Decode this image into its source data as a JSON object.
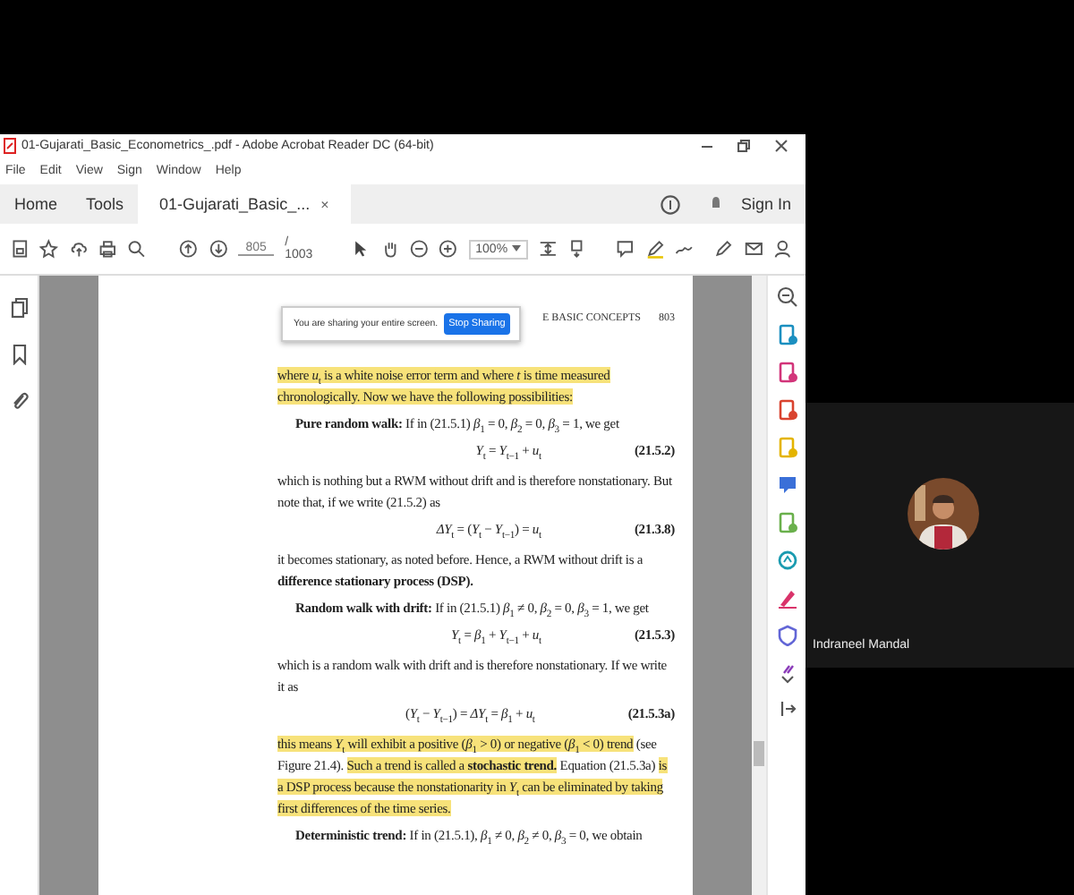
{
  "window": {
    "title": "01-Gujarati_Basic_Econometrics_.pdf - Adobe Acrobat Reader DC (64-bit)"
  },
  "menu": [
    "File",
    "Edit",
    "View",
    "Sign",
    "Window",
    "Help"
  ],
  "tabs": [
    {
      "label": "Home",
      "selected": false
    },
    {
      "label": "Tools",
      "selected": false
    },
    {
      "label": "01-Gujarati_Basic_...",
      "selected": true,
      "close": "×"
    }
  ],
  "sign_in": "Sign In",
  "toolbar": {
    "page": "805",
    "page_total": "/ 1003",
    "zoom": "100%"
  },
  "share_banner": {
    "message": "You are sharing your entire screen.",
    "button": "Stop Sharing"
  },
  "page": {
    "running_head": "E BASIC CONCEPTS",
    "page_number": "803",
    "blocks": [
      {
        "kind": "para",
        "indent": false,
        "segments": [
          {
            "text": "where *u*$_{t}$ is a white noise error term and where *t* is time measured chronologically. Now we have the following possibilities:",
            "highlighted": true
          }
        ]
      },
      {
        "kind": "para",
        "indent": true,
        "segments": [
          {
            "text": "**Pure random walk:** If in (21.5.1) *β*$_{1}$ = 0, *β*$_{2}$ = 0, *β*$_{3}$ = 1, we get",
            "highlighted": false
          }
        ]
      },
      {
        "kind": "equation",
        "formula": "*Y*$_{t}$ = *Y*$_{t−1}$ + *u*$_{t}$",
        "number": "(21.5.2)"
      },
      {
        "kind": "para",
        "indent": false,
        "segments": [
          {
            "text": "which is nothing but a RWM without drift and is therefore nonstationary. But note that, if we write (21.5.2) as",
            "highlighted": false
          }
        ]
      },
      {
        "kind": "equation",
        "formula": "*ΔY*$_{t}$ = (*Y*$_{t}$ − *Y*$_{t−1}$) = *u*$_{t}$",
        "number": "(21.3.8)"
      },
      {
        "kind": "para",
        "indent": false,
        "segments": [
          {
            "text": "it becomes stationary, as noted before. Hence, a RWM without drift is a **difference stationary process (DSP).**",
            "highlighted": false
          }
        ]
      },
      {
        "kind": "para",
        "indent": true,
        "segments": [
          {
            "text": "**Random walk with drift:** If in (21.5.1) *β*$_{1}$ ≠ 0, *β*$_{2}$ = 0, *β*$_{3}$ = 1, we get",
            "highlighted": false
          }
        ]
      },
      {
        "kind": "equation",
        "formula": "*Y*$_{t}$ = *β*$_{1}$ + *Y*$_{t−1}$ + *u*$_{t}$",
        "number": "(21.5.3)"
      },
      {
        "kind": "para",
        "indent": false,
        "segments": [
          {
            "text": "which is a random walk with drift and is therefore nonstationary. If we write it as",
            "highlighted": false
          }
        ]
      },
      {
        "kind": "equation",
        "formula": "(*Y*$_{t}$ − *Y*$_{t−1}$) = *ΔY*$_{t}$ = *β*$_{1}$ + *u*$_{t}$",
        "number": "(21.5.3a)"
      },
      {
        "kind": "para",
        "indent": false,
        "segments": [
          {
            "text": "this means *Y*$_{t}$ will exhibit a positive (*β*$_{1}$ > 0) or negative (*β*$_{1}$ < 0) trend",
            "highlighted": true
          },
          {
            "text": " (see Figure 21.4). ",
            "highlighted": false
          },
          {
            "text": "Such a trend is called a **stochastic trend.**",
            "highlighted": true
          },
          {
            "text": " Equation (21.5.3a) ",
            "highlighted": false
          },
          {
            "text": "is a DSP process because the nonstationarity in *Y*$_{t}$ can be eliminated by taking first differences of the time series.",
            "highlighted": true
          }
        ]
      },
      {
        "kind": "para",
        "indent": true,
        "segments": [
          {
            "text": "**Deterministic trend:** If in (21.5.1), *β*$_{1}$ ≠ 0, *β*$_{2}$ ≠ 0, *β*$_{3}$ = 0, we obtain",
            "highlighted": false
          }
        ]
      }
    ]
  },
  "participant": {
    "name": "Indraneel Mandal"
  }
}
